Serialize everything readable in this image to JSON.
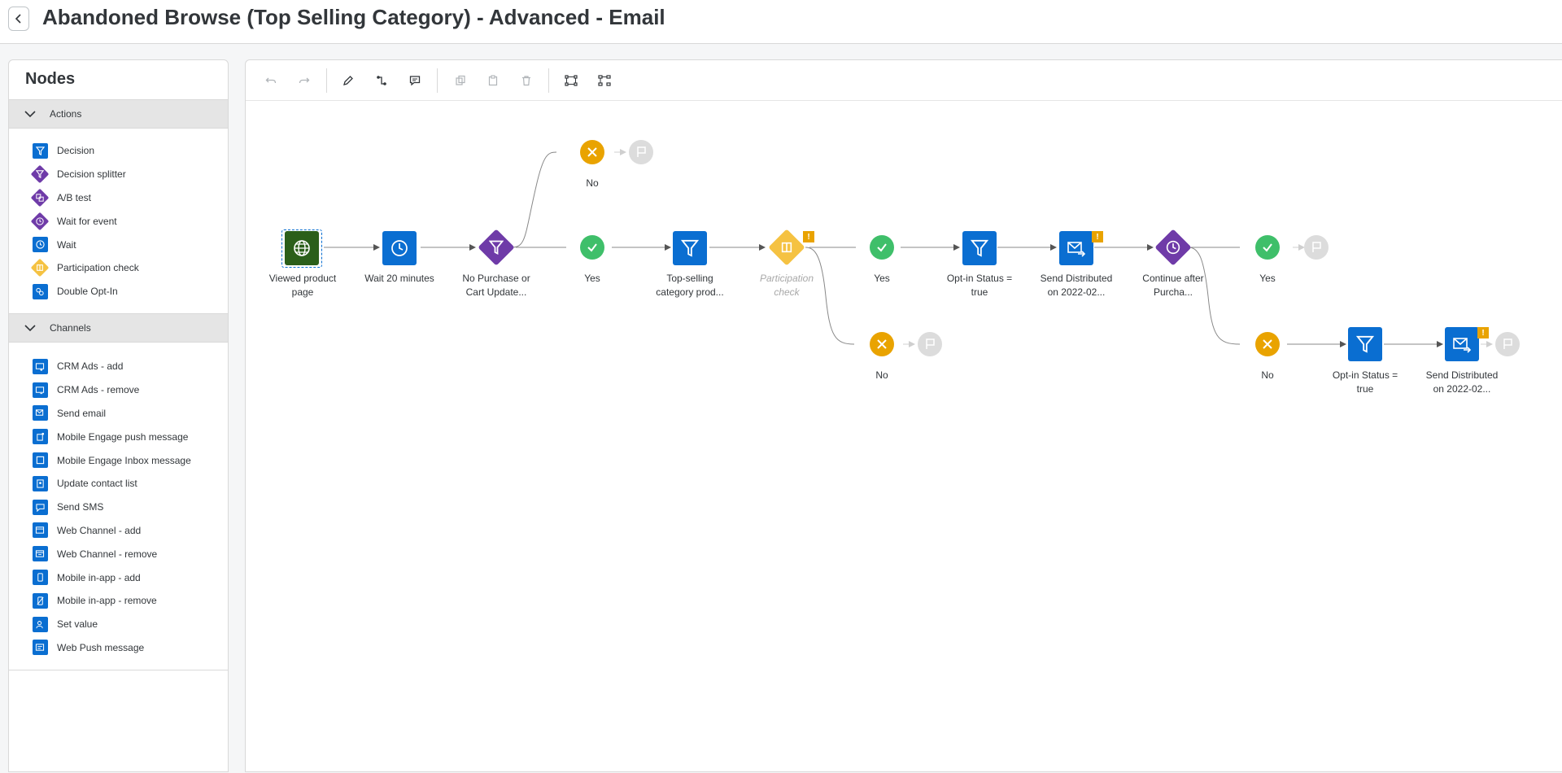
{
  "header": {
    "title": "Abandoned Browse (Top Selling Category) - Advanced - Email"
  },
  "panel": {
    "title": "Nodes",
    "actions_label": "Actions",
    "actions": [
      {
        "label": "Decision",
        "icon": "filter-icon"
      },
      {
        "label": "Decision splitter",
        "icon": "filter-icon"
      },
      {
        "label": "A/B test",
        "icon": "ab-test-icon"
      },
      {
        "label": "Wait for event",
        "icon": "clock-icon"
      },
      {
        "label": "Wait",
        "icon": "clock-icon"
      },
      {
        "label": "Participation check",
        "icon": "participation-icon"
      },
      {
        "label": "Double Opt-In",
        "icon": "double-opt-in-icon"
      }
    ],
    "channels_label": "Channels",
    "channels": [
      {
        "label": "CRM Ads - add",
        "icon": "ads-add-icon"
      },
      {
        "label": "CRM Ads - remove",
        "icon": "ads-remove-icon"
      },
      {
        "label": "Send email",
        "icon": "email-icon"
      },
      {
        "label": "Mobile Engage push message",
        "icon": "push-icon"
      },
      {
        "label": "Mobile Engage Inbox message",
        "icon": "inbox-icon"
      },
      {
        "label": "Update contact list",
        "icon": "contact-list-icon"
      },
      {
        "label": "Send SMS",
        "icon": "sms-icon"
      },
      {
        "label": "Web Channel - add",
        "icon": "web-add-icon"
      },
      {
        "label": "Web Channel - remove",
        "icon": "web-remove-icon"
      },
      {
        "label": "Mobile in-app - add",
        "icon": "mobile-icon"
      },
      {
        "label": "Mobile in-app - remove",
        "icon": "mobile-remove-icon"
      },
      {
        "label": "Set value",
        "icon": "set-value-icon"
      },
      {
        "label": "Web Push message",
        "icon": "web-push-icon"
      }
    ]
  },
  "flow": {
    "labels": {
      "viewed": [
        "Viewed product",
        "page"
      ],
      "wait20": [
        "Wait 20 minutes"
      ],
      "nopurchase": [
        "No Purchase or",
        "Cart Update..."
      ],
      "no1": [
        "No"
      ],
      "yes1": [
        "Yes"
      ],
      "topselling": [
        "Top-selling",
        "category prod..."
      ],
      "partcheck": [
        "Participation",
        "check"
      ],
      "yes2": [
        "Yes"
      ],
      "no2": [
        "No"
      ],
      "optin1": [
        "Opt-in Status =",
        "true"
      ],
      "send1": [
        "Send Distributed",
        "on 2022-02..."
      ],
      "continue": [
        "Continue after",
        "Purcha..."
      ],
      "yes3": [
        "Yes"
      ],
      "no3": [
        "No"
      ],
      "optin2": [
        "Opt-in Status =",
        "true"
      ],
      "send2": [
        "Send Distributed",
        "on 2022-02..."
      ]
    },
    "warning_mark": "!"
  },
  "colors": {
    "blue": "#0a6ed1",
    "purple": "#6f3ba8",
    "green_node": "#2b5f1a",
    "yes_green": "#3fbf6a",
    "no_orange": "#e9a300",
    "participation_yellow": "#f5c242"
  }
}
